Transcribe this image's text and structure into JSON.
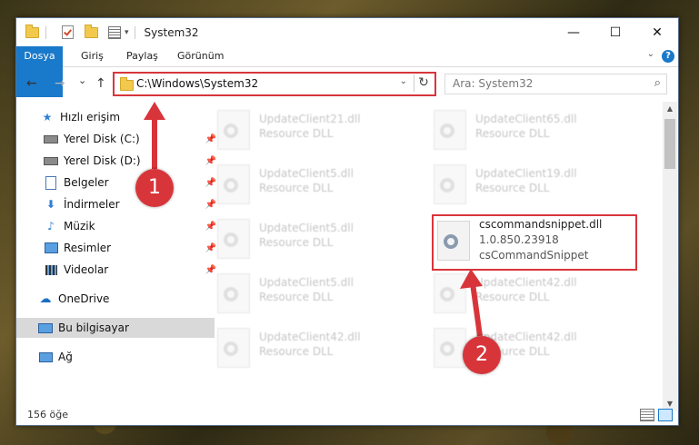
{
  "window": {
    "title": "System32",
    "min_glyph": "—",
    "max_glyph": "☐",
    "close_glyph": "✕"
  },
  "ribbon": {
    "tabs": [
      "Dosya",
      "Giriş",
      "Paylaş",
      "Görünüm"
    ],
    "help_glyph": "?",
    "accent_color": "#1979ca"
  },
  "nav": {
    "back_glyph": "←",
    "forward_glyph": "→",
    "recent_glyph": "⌄",
    "up_glyph": "↑",
    "address": "C:\\Windows\\System32",
    "refresh_glyph": "↻",
    "search_placeholder": "Ara: System32"
  },
  "sidebar": {
    "items": [
      {
        "label": "Hızlı erişim",
        "icon": "star-icon"
      },
      {
        "label": "Yerel Disk (C:)",
        "icon": "drive-icon"
      },
      {
        "label": "Yerel Disk (D:)",
        "icon": "drive-icon"
      },
      {
        "label": "Belgeler",
        "icon": "document-icon"
      },
      {
        "label": "İndirmeler",
        "icon": "download-icon"
      },
      {
        "label": "Müzik",
        "icon": "music-icon"
      },
      {
        "label": "Resimler",
        "icon": "picture-icon"
      },
      {
        "label": "Videolar",
        "icon": "video-icon"
      },
      {
        "label": "OneDrive",
        "icon": "cloud-icon"
      },
      {
        "label": "Bu bilgisayar",
        "icon": "computer-icon"
      },
      {
        "label": "Ağ",
        "icon": "network-icon"
      }
    ]
  },
  "files": [
    {
      "name": "UpdateClient21.dll",
      "type": "Resource DLL"
    },
    {
      "name": "UpdateClient65.dll",
      "type": "Resource DLL"
    },
    {
      "name": "UpdateClient5.dll",
      "type": "Resource DLL"
    },
    {
      "name": "UpdateClient19.dll",
      "type": "Resource DLL"
    },
    {
      "name": "UpdateClient5.dll",
      "type": "Resource DLL"
    },
    {
      "name": "cscommandsnippet.dll",
      "version": "1.0.850.23918",
      "type": "csCommandSnippet"
    },
    {
      "name": "UpdateClient5.dll",
      "type": "Resource DLL"
    },
    {
      "name": "UpdateClient42.dll",
      "type": "Resource DLL"
    },
    {
      "name": "UpdateClient42.dll",
      "type": "Resource DLL"
    },
    {
      "name": "UpdateClient42.dll",
      "type": "Resource DLL"
    }
  ],
  "status": {
    "item_count": "156 öğe"
  },
  "annotations": {
    "step1": "1",
    "step2": "2",
    "color": "#d8353b"
  }
}
